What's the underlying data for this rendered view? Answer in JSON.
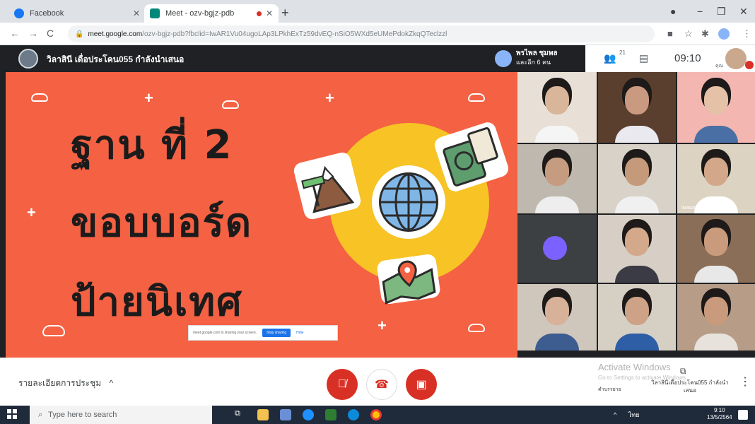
{
  "browser": {
    "tabs": [
      {
        "label": "Facebook",
        "icon": "facebook-icon",
        "color": "#1877f2",
        "active": false
      },
      {
        "label": "Meet - ozv-bgjz-pdb",
        "icon": "meet-icon",
        "color": "#00897b",
        "active": true
      }
    ],
    "url_domain": "meet.google.com",
    "url_rest": "/ozv-bgjz-pdb?fbclid=IwAR1Vu04ugoLAp3LPkhExTz59dvEQ-nSiO5WXd5eUMePdokZkqQTeclzzl"
  },
  "meeting": {
    "presenter_title": "วิลาสินี เดื่อประโคน055 กำลังนำเสนอ",
    "pinned_name": "พรไพล ชุมพล",
    "pinned_sub": "และอีก 6 คน",
    "participant_count": "21",
    "clock": "09:10",
    "self_label": "คุณ"
  },
  "slide": {
    "line1": "ฐาน ที่ 2",
    "line2": "ขอบบอร์ด",
    "line3": "ป้ายนิเทศ",
    "share_text": "meet.google.com is sharing your screen.",
    "stop_label": "Stop sharing",
    "hide_label": "Hide"
  },
  "tiles": [
    {
      "name": "",
      "bg": "#e8e0d6",
      "skin": "#d9b59a",
      "shirt": "#f5f5f5"
    },
    {
      "name": "",
      "bg": "#5a3e2e",
      "skin": "#c99a7f",
      "shirt": "#e9e9ef"
    },
    {
      "name": "",
      "bg": "#f4b6b0",
      "skin": "#e5c1a8",
      "shirt": "#4a6fa5"
    },
    {
      "name": "",
      "bg": "#bfb8ae",
      "skin": "#c69c80",
      "shirt": "#eeeeee"
    },
    {
      "name": "",
      "bg": "#d8d2c8",
      "skin": "#c59a7b",
      "shirt": "#f0f0f0"
    },
    {
      "name": "Wasana Suk",
      "bg": "#dcd3c2",
      "skin": "#d3a88a",
      "shirt": "#ffffff"
    },
    {
      "name": "",
      "bg": "#3c4043",
      "skin": "",
      "shirt": ""
    },
    {
      "name": "",
      "bg": "#d7cfc6",
      "skin": "#d4a98b",
      "shirt": "#3b3b45"
    },
    {
      "name": "",
      "bg": "#8a6e58",
      "skin": "#c99b7c",
      "shirt": "#e8e8e8"
    },
    {
      "name": "",
      "bg": "#cfc6bc",
      "skin": "#d8b199",
      "shirt": "#3d5c8f"
    },
    {
      "name": "",
      "bg": "#d6cfc4",
      "skin": "#cda286",
      "shirt": "#2d5ea6"
    },
    {
      "name": "",
      "bg": "#b79c88",
      "skin": "#c99a7c",
      "shirt": "#e7e2dc"
    }
  ],
  "controls": {
    "meeting_details": "รายละเอียดการประชุม",
    "activate_title": "Activate Windows",
    "activate_sub": "Go to Settings to activate Windows.",
    "captions_label": "คำบรรยาย",
    "present_label": "วิลาสินีเดื่อประโคน055 กำลังนำเสนอ"
  },
  "taskbar": {
    "search_placeholder": "Type here to search",
    "time": "9:10",
    "date": "13/5/2564",
    "lang": "ไทย"
  },
  "colors": {
    "slide_bg": "#f46143",
    "sun": "#f7c325",
    "end_call": "#d93025",
    "meet_header": "#202124"
  }
}
